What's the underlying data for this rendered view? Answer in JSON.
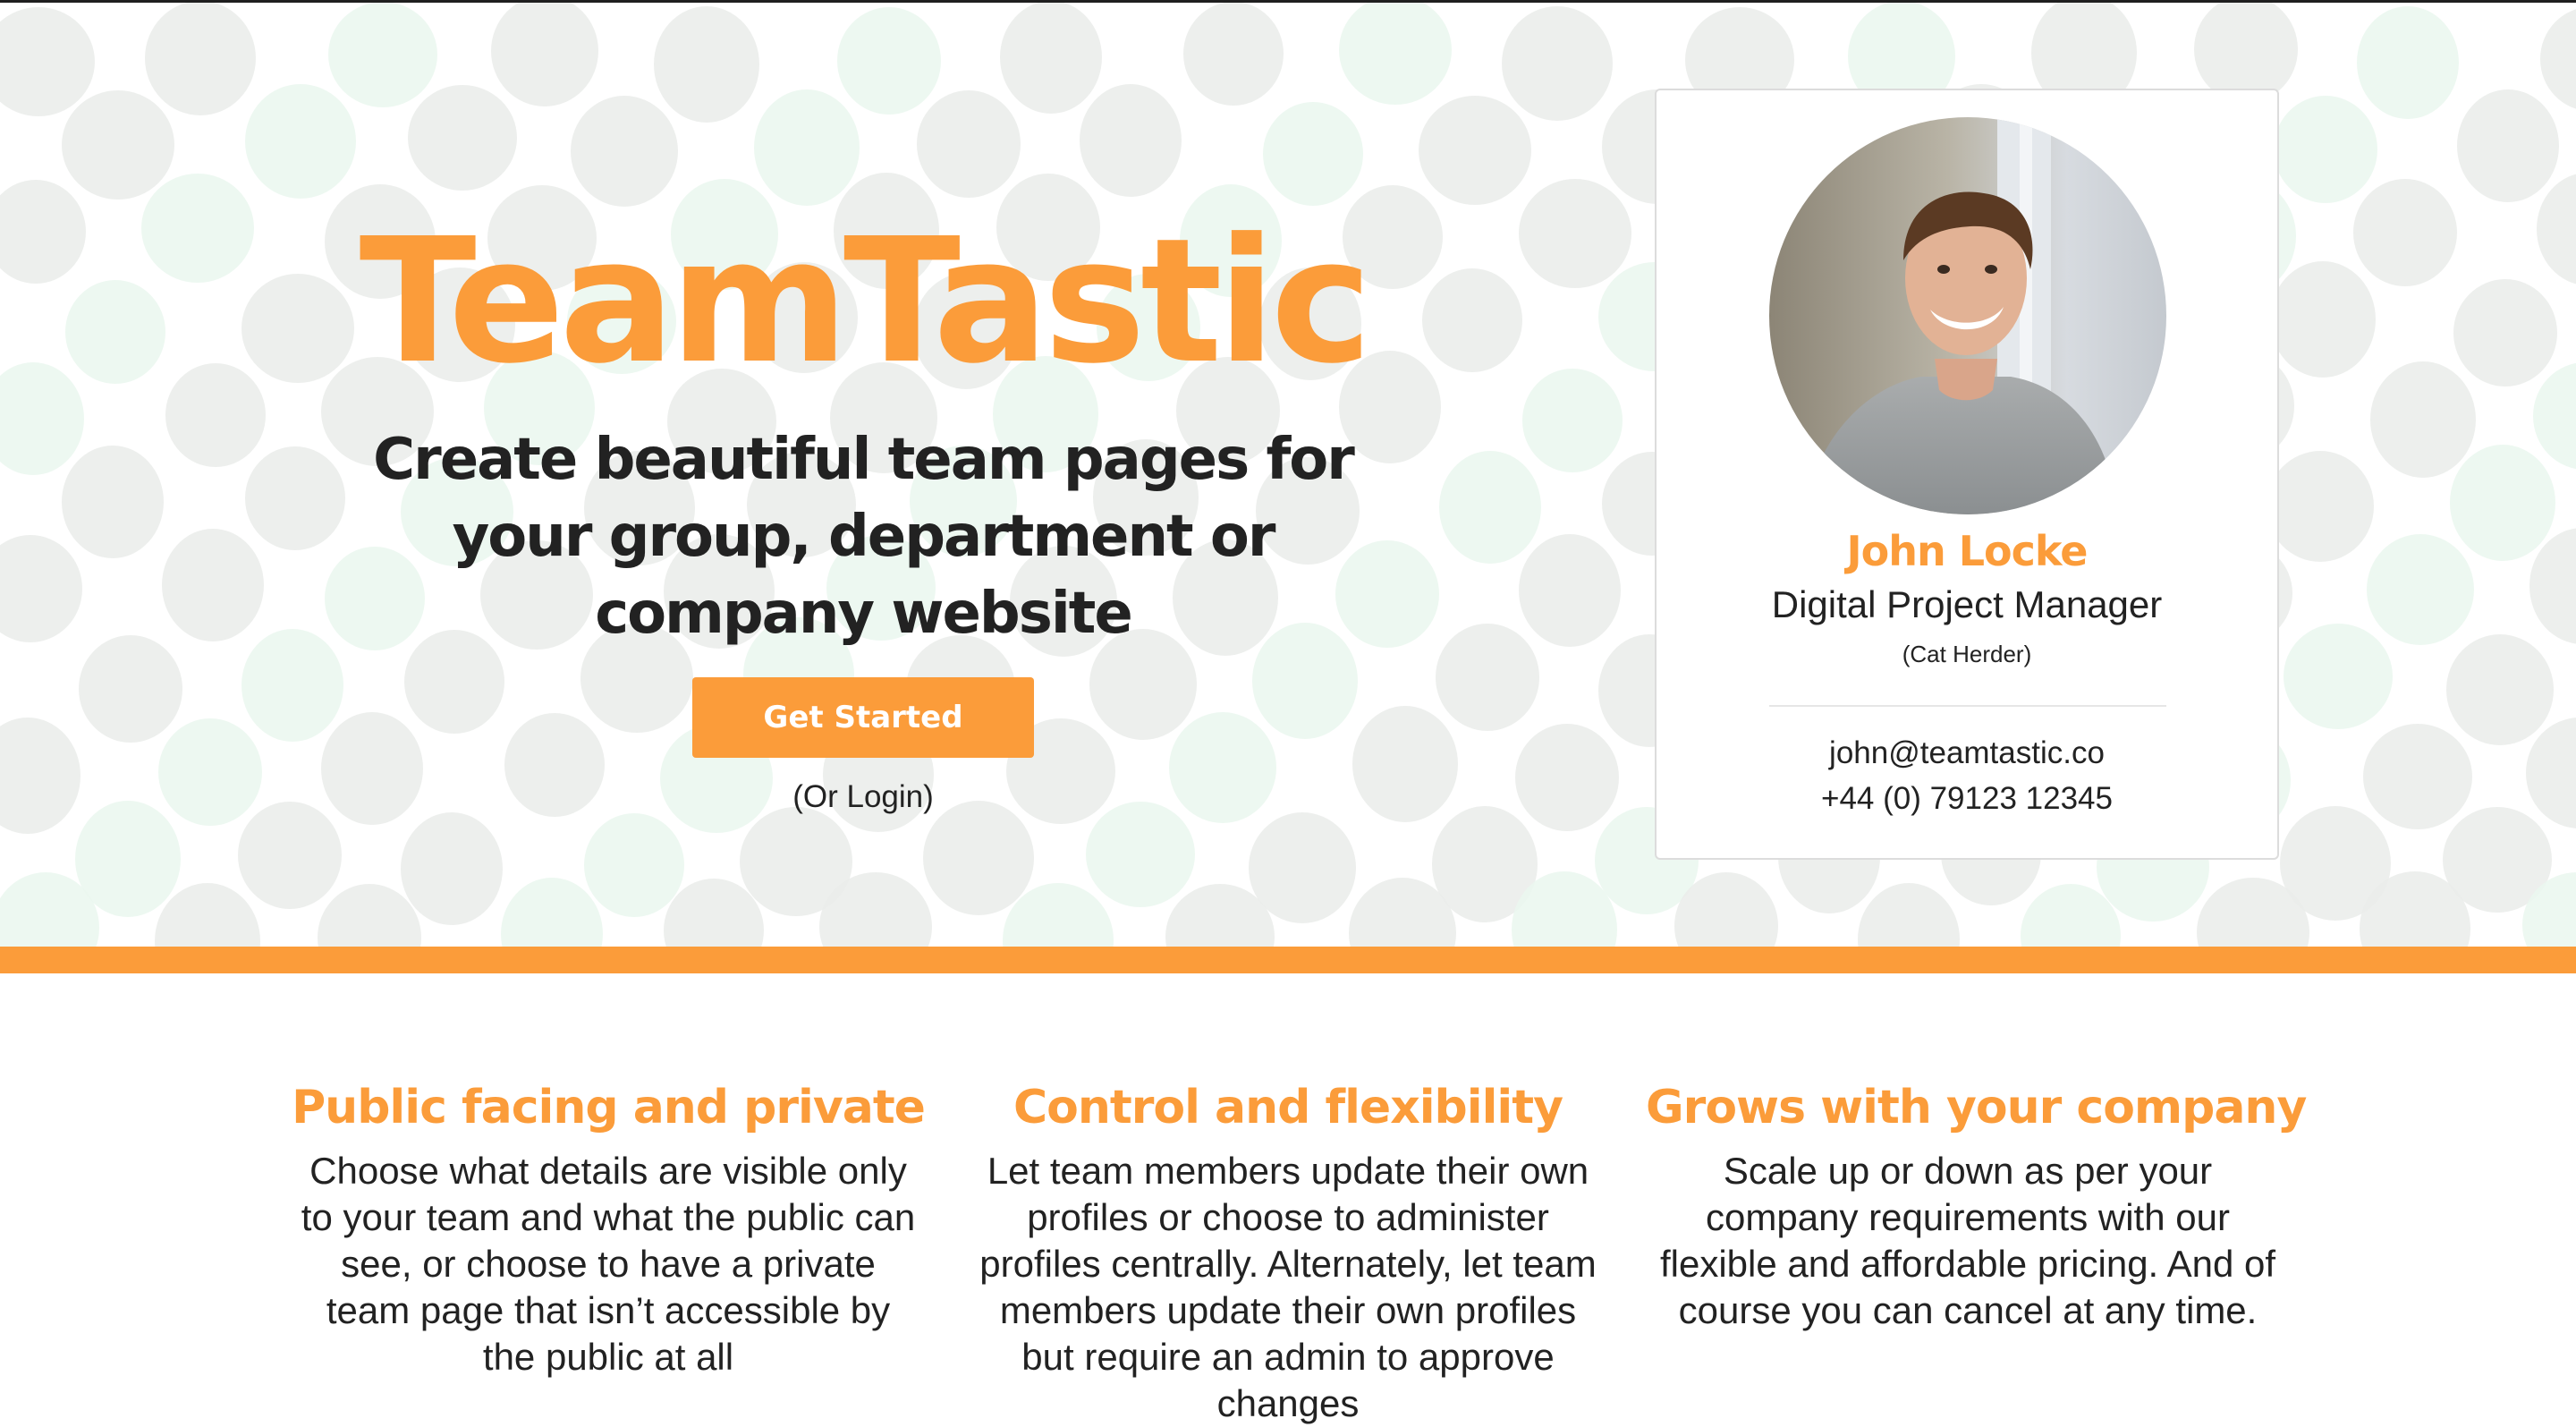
{
  "hero": {
    "title": "TeamTastic",
    "tagline": "Create beautiful team pages for your group, department or company website",
    "cta_label": "Get Started",
    "login_label": "(Or Login)"
  },
  "profile_card": {
    "avatar_icon": "person-photo-icon",
    "name": "John Locke",
    "role": "Digital Project Manager",
    "nickname": "(Cat Herder)",
    "email": "john@teamtastic.co",
    "phone": "+44 (0) 79123 12345"
  },
  "features": [
    {
      "title": "Public facing and private",
      "body": "Choose what details are visible only to your team and what the public can see, or choose to have a private team page that isn’t accessible by the public at all"
    },
    {
      "title": "Control and flexibility",
      "body": "Let team members update their own profiles or choose to administer profiles centrally. Alternately, let team members update their own profiles but require an admin to approve changes"
    },
    {
      "title": "Grows with your company",
      "body": "Scale up or down as per your company requirements with our flexible and affordable pricing. And of course you can cancel at any time."
    }
  ],
  "colors": {
    "accent": "#fb9c3a",
    "text": "#222222",
    "dot_grey": "#eaecea",
    "dot_green": "#eaf7ee"
  }
}
